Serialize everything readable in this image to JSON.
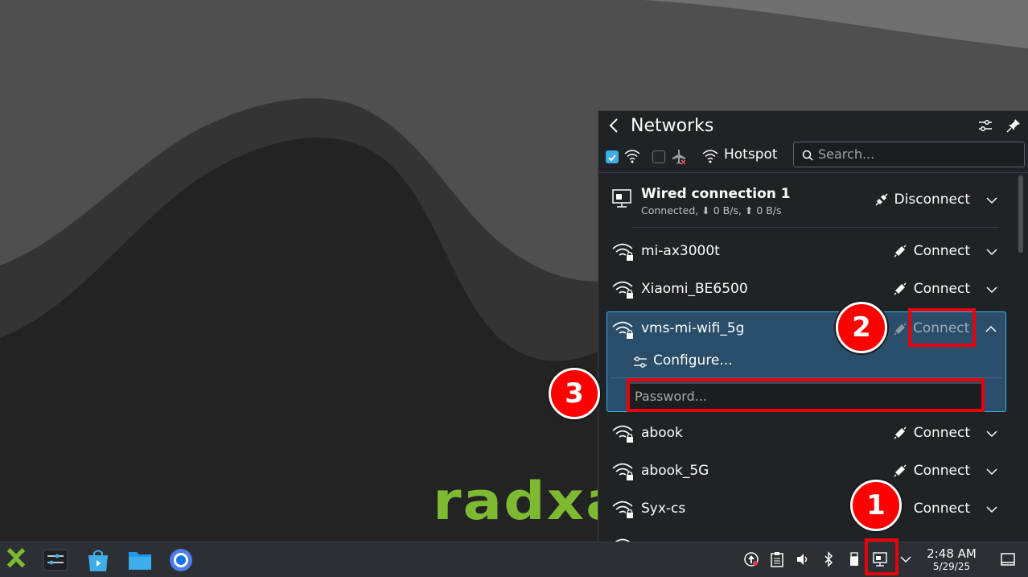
{
  "desktop": {
    "logo_text": "radxa"
  },
  "panel": {
    "title": "Networks",
    "hotspot_label": "Hotspot",
    "search_placeholder": "Search...",
    "wired": {
      "name": "Wired connection 1",
      "status": "Connected, ⬇ 0 B/s, ⬆ 0 B/s",
      "action": "Disconnect"
    },
    "networks": [
      {
        "name": "mi-ax3000t",
        "action": "Connect"
      },
      {
        "name": "Xiaomi_BE6500",
        "action": "Connect"
      },
      {
        "name": "vms-mi-wifi_5g",
        "action": "Connect"
      },
      {
        "name": "abook",
        "action": "Connect"
      },
      {
        "name": "abook_5G",
        "action": "Connect"
      },
      {
        "name": "Syx-cs",
        "action": "Connect"
      }
    ],
    "configure_label": "Configure...",
    "password_placeholder": "Password..."
  },
  "taskbar": {
    "time": "2:48 AM",
    "date": "5/29/25"
  },
  "annotations": [
    "1",
    "2",
    "3"
  ],
  "colors": {
    "accent": "#3daee9",
    "selected_bg": "#2a4e69",
    "annotation_red": "#e8000b",
    "logo_green": "#7dba32"
  }
}
